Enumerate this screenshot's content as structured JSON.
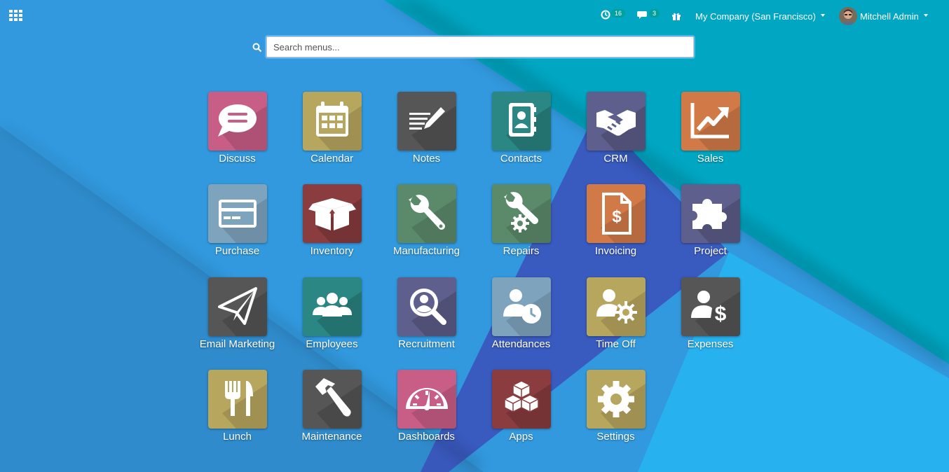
{
  "topbar": {
    "apps_menu_icon": "grid-icon",
    "activity_icon": "clock-icon",
    "activity_count": "16",
    "messages_icon": "chat-icon",
    "messages_count": "3",
    "gift_icon": "gift-icon",
    "company": "My Company (San Francisco)",
    "user_name": "Mitchell Admin"
  },
  "search": {
    "placeholder": "Search menus...",
    "icon": "search-icon"
  },
  "apps": [
    {
      "label": "Discuss",
      "color": "#c85d86",
      "icon": "chat-bubble-icon"
    },
    {
      "label": "Calendar",
      "color": "#b7a65e",
      "icon": "calendar-icon"
    },
    {
      "label": "Notes",
      "color": "#565656",
      "icon": "notes-icon"
    },
    {
      "label": "Contacts",
      "color": "#2a8784",
      "icon": "address-book-icon"
    },
    {
      "label": "CRM",
      "color": "#5e5f8c",
      "icon": "handshake-icon"
    },
    {
      "label": "Sales",
      "color": "#d17a47",
      "icon": "chart-line-icon"
    },
    {
      "label": "Purchase",
      "color": "#7ea3bd",
      "icon": "credit-card-icon"
    },
    {
      "label": "Inventory",
      "color": "#8a3c3f",
      "icon": "box-icon"
    },
    {
      "label": "Manufacturing",
      "color": "#5b8a6b",
      "icon": "wrench-icon"
    },
    {
      "label": "Repairs",
      "color": "#5b8a6b",
      "icon": "wrench-gear-icon"
    },
    {
      "label": "Invoicing",
      "color": "#d17a47",
      "icon": "invoice-icon"
    },
    {
      "label": "Project",
      "color": "#5e5f8c",
      "icon": "puzzle-icon"
    },
    {
      "label": "Email Marketing",
      "color": "#565656",
      "icon": "paper-plane-icon"
    },
    {
      "label": "Employees",
      "color": "#2a8784",
      "icon": "users-icon"
    },
    {
      "label": "Recruitment",
      "color": "#5e5f8c",
      "icon": "magnifier-user-icon"
    },
    {
      "label": "Attendances",
      "color": "#7ea3bd",
      "icon": "user-clock-icon"
    },
    {
      "label": "Time Off",
      "color": "#b7a65e",
      "icon": "user-sun-icon"
    },
    {
      "label": "Expenses",
      "color": "#565656",
      "icon": "user-dollar-icon"
    },
    {
      "label": "Lunch",
      "color": "#b7a65e",
      "icon": "cutlery-icon"
    },
    {
      "label": "Maintenance",
      "color": "#565656",
      "icon": "hammer-icon"
    },
    {
      "label": "Dashboards",
      "color": "#c85d86",
      "icon": "gauge-icon"
    },
    {
      "label": "Apps",
      "color": "#8a3c3f",
      "icon": "cubes-icon"
    },
    {
      "label": "Settings",
      "color": "#b7a65e",
      "icon": "gear-icon"
    }
  ]
}
